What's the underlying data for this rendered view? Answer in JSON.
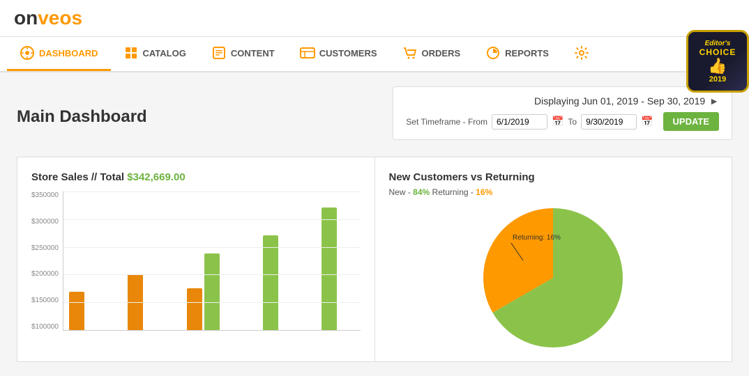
{
  "logo": {
    "text_pre": "on",
    "text_brand": "veos"
  },
  "nav": {
    "items": [
      {
        "id": "dashboard",
        "label": "DASHBOARD",
        "icon": "dashboard-icon",
        "active": true
      },
      {
        "id": "catalog",
        "label": "CATALOG",
        "icon": "catalog-icon",
        "active": false
      },
      {
        "id": "content",
        "label": "CONTENT",
        "icon": "content-icon",
        "active": false
      },
      {
        "id": "customers",
        "label": "CUSTOMERS",
        "icon": "customers-icon",
        "active": false
      },
      {
        "id": "orders",
        "label": "ORDERS",
        "icon": "orders-icon",
        "active": false
      },
      {
        "id": "reports",
        "label": "REPORTS",
        "icon": "reports-icon",
        "active": false
      },
      {
        "id": "settings",
        "label": "",
        "icon": "settings-icon",
        "active": false
      }
    ]
  },
  "badge": {
    "line1": "Editor's",
    "line2": "CHOICE",
    "year": "2019"
  },
  "page": {
    "title": "Main Dashboard"
  },
  "timeframe": {
    "display_label": "Displaying Jun 01, 2019 - Sep 30, 2019",
    "from_label": "Set Timeframe - From",
    "from_value": "6/1/2019",
    "to_label": "To",
    "to_value": "9/30/2019",
    "update_label": "UPDATE"
  },
  "store_sales": {
    "title_prefix": "Store Sales // Total ",
    "total": "$342,669.00",
    "y_labels": [
      "$350000",
      "$300000",
      "$250000",
      "$200000",
      "$150000",
      "$100000"
    ],
    "bars": [
      {
        "orange_pct": 28,
        "green_pct": 0
      },
      {
        "orange_pct": 42,
        "green_pct": 0
      },
      {
        "orange_pct": 30,
        "green_pct": 55
      },
      {
        "orange_pct": 0,
        "green_pct": 68
      },
      {
        "orange_pct": 0,
        "green_pct": 88
      }
    ]
  },
  "new_vs_returning": {
    "title": "New Customers vs Returning",
    "new_label": "New - ",
    "new_pct": "84",
    "new_unit": "%",
    "returning_label": " Returning - ",
    "returning_pct": "16",
    "returning_unit": "%",
    "pie_label": "Returning: 16%"
  },
  "colors": {
    "green": "#8bc34a",
    "orange": "#f90",
    "dark_orange": "#e8870a",
    "accent_green": "#6db33f"
  }
}
